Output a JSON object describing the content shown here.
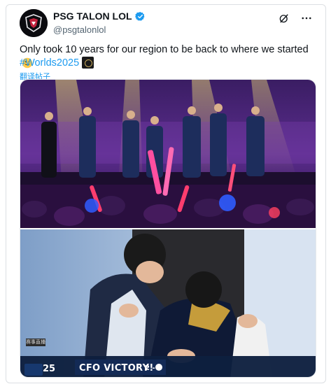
{
  "tweet": {
    "author_name": "PSG TALON LOL",
    "author_handle": "@psgtalonlol",
    "text": "Only took 10 years for our region to be back to where we started",
    "text_emoji": "slightly-smiling-face-emoji",
    "hashtag": "#Worlds2025",
    "translate_label": "翻译帖子"
  },
  "icons": {
    "avatar": "psg-talon-logo",
    "verified": "verified-badge-icon",
    "grok": "grok-icon",
    "more": "more-options-icon"
  },
  "media": {
    "stream_tag": "赛事直播",
    "banner": {
      "series_number": "25",
      "victory_text": "CFO VICTORY!",
      "score": "2 - 0"
    }
  },
  "colors": {
    "link": "#1d9bf0",
    "verified": "#1d9bf0",
    "banner_bg": "#0e1f3e",
    "stage_purple": "#5b2d8e"
  }
}
